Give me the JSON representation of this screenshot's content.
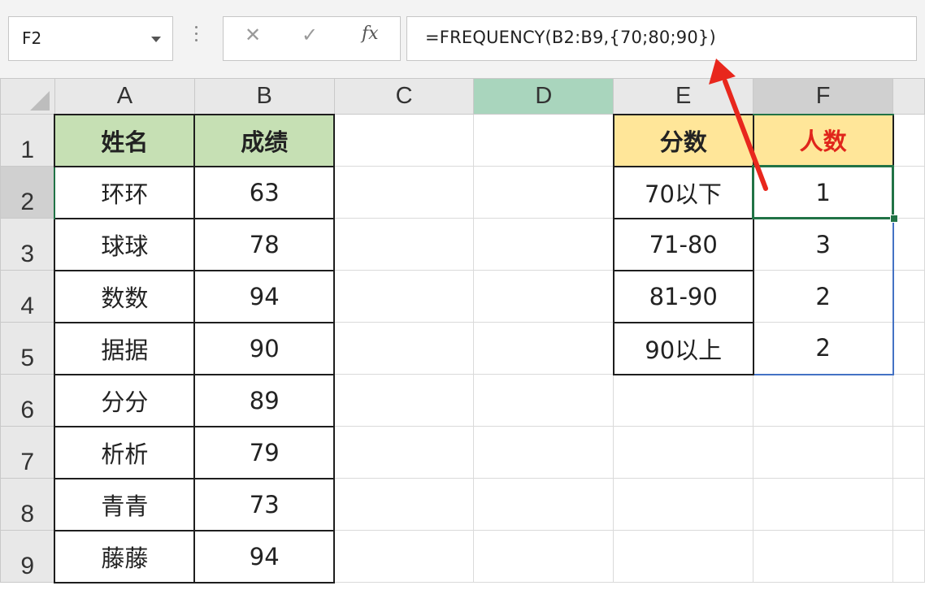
{
  "name_box": {
    "value": "F2"
  },
  "formula_bar": {
    "cancel_glyph": "✕",
    "enter_glyph": "✓",
    "fx_glyph": "fx",
    "formula": "=FREQUENCY(B2:B9,{70;80;90})"
  },
  "columns": [
    "A",
    "B",
    "C",
    "D",
    "E",
    "F"
  ],
  "rows": [
    "1",
    "2",
    "3",
    "4",
    "5",
    "6",
    "7",
    "8",
    "9"
  ],
  "table1": {
    "header_name": "姓名",
    "header_score": "成绩",
    "rows": [
      {
        "name": "环环",
        "score": "63"
      },
      {
        "name": "球球",
        "score": "78"
      },
      {
        "name": "数数",
        "score": "94"
      },
      {
        "name": "据据",
        "score": "90"
      },
      {
        "name": "分分",
        "score": "89"
      },
      {
        "name": "析析",
        "score": "79"
      },
      {
        "name": "青青",
        "score": "73"
      },
      {
        "name": "藤藤",
        "score": "94"
      }
    ]
  },
  "table2": {
    "header_range": "分数",
    "header_count": "人数",
    "rows": [
      {
        "range": "70以下",
        "count": "1"
      },
      {
        "range": "71-80",
        "count": "3"
      },
      {
        "range": "81-90",
        "count": "2"
      },
      {
        "range": "90以上",
        "count": "2"
      }
    ]
  },
  "colors": {
    "green_header": "#c6e0b4",
    "yellow_header": "#ffe699",
    "red_text": "#e0251b",
    "selection": "#217346",
    "spill_border": "#4472c4",
    "arrow": "#e8271d"
  }
}
